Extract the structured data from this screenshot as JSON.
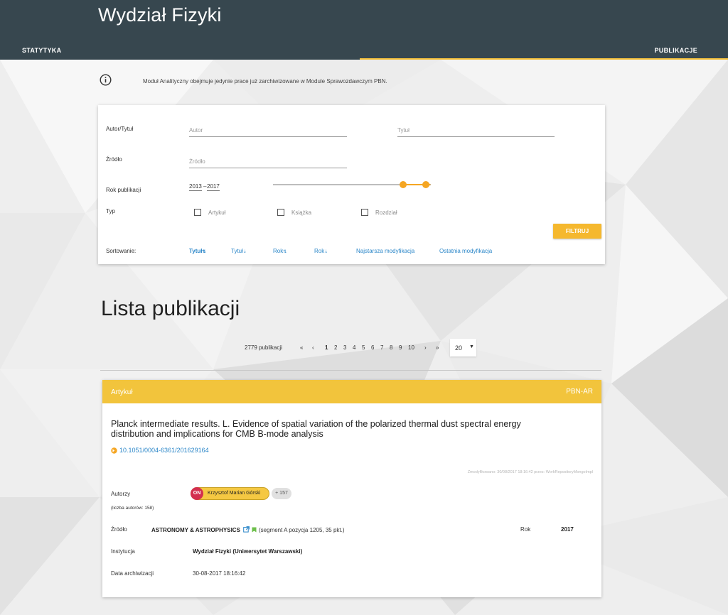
{
  "header": {
    "title": "Wydział Fizyki",
    "tabs": [
      {
        "label": "STATYTYKA"
      },
      {
        "label": "PUBLIKACJE",
        "active": true
      }
    ],
    "indicator_color": "#f5c13a",
    "bg_color": "#37474f"
  },
  "info": {
    "icon": "info-icon",
    "text": "Moduł Analityczny obejmuje jedynie prace już zarchiwizowane w Module Sprawozdawczym PBN."
  },
  "filter": {
    "author_title_label": "Autor/Tytuł",
    "author_placeholder": "Autor",
    "title_placeholder": "Tytuł",
    "source_label": "Źródło",
    "source_placeholder": "Źródło",
    "year_label": "Rok publikacji",
    "year_from": "2013",
    "year_dash": "–",
    "year_to": "2017",
    "type_label": "Typ",
    "types": [
      {
        "label": "Artykuł",
        "checked": false
      },
      {
        "label": "Książka",
        "checked": false
      },
      {
        "label": "Rozdział",
        "checked": false
      }
    ],
    "filter_button": "FILTRUJ",
    "sort_label": "Sortowanie:",
    "sort_options": [
      {
        "label": "Tytuł",
        "active": true
      },
      {
        "label": "Tytuł",
        "active": false
      },
      {
        "label": "Rok",
        "active": false
      },
      {
        "label": "Rok",
        "active": false
      },
      {
        "label": "Najstarsza modyfikacja",
        "active": false
      },
      {
        "label": "Ostatnia modyfikacja",
        "active": false
      }
    ],
    "accent_color": "#f5a623"
  },
  "list": {
    "title": "Lista publikacji",
    "count": "2779 publikacji",
    "pagination": {
      "first": "«",
      "prev": "‹",
      "pages": [
        "1",
        "2",
        "3",
        "4",
        "5",
        "6",
        "7",
        "8",
        "9",
        "10"
      ],
      "current": "1",
      "next": "›",
      "last": "»"
    },
    "page_size": "20",
    "page_size_caret": "▼"
  },
  "publication": {
    "type": "Artykuł",
    "code": "PBN-AR",
    "header_color": "#f2c43c",
    "title": "Planck intermediate results. L. Evidence of spatial variation of the polarized thermal dust spectral energy distribution and implications for CMB B-mode analysis",
    "doi": "10.1051/0004-6361/201629164",
    "modified": "Zmodyfikowano: 30/08/2017 18:16:42 przez: WorkRepositoryMongoImpl",
    "authors_label": "Autorzy",
    "authors_count": "(liczba autorów: 158)",
    "orcid_badge": "ON",
    "author_name": "Krzysztof Marian Górski",
    "more_authors": "+ 157",
    "source_label": "Źródło",
    "source_name": "ASTRONOMY & ASTROPHYSICS",
    "source_segment": "(segment A pozycja 1205, 35 pkt.)",
    "year_label": "Rok",
    "year": "2017",
    "institution_label": "Instytucja",
    "institution": "Wydział Fizyki (Uniwersytet Warszawski)",
    "archive_label": "Data archiwizacji",
    "archive_date": "30-08-2017 18:16:42"
  }
}
